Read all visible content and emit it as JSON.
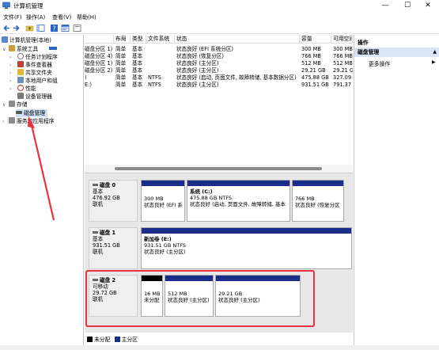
{
  "window": {
    "title": "计算机管理",
    "controls": {
      "minimize": "—",
      "maximize": "☐",
      "close": "✕"
    }
  },
  "menu": [
    "文件(F)",
    "操作(A)",
    "查看(V)",
    "帮助(H)"
  ],
  "tree": {
    "root": "计算机管理(本地)",
    "system_tools": "系统工具",
    "task_scheduler": "任务计划程序",
    "event_viewer": "事件查看器",
    "shared_folders": "共享文件夹",
    "local_users": "本地用户和组",
    "performance": "性能",
    "device_manager": "设备管理器",
    "storage": "存储",
    "disk_management": "磁盘管理",
    "services": "服务和应用程序"
  },
  "list": {
    "columns": [
      "布局",
      "类型",
      "文件系统",
      "状态",
      "容量",
      "可用空间"
    ],
    "rows": [
      {
        "name": "磁盘分区 1)",
        "layout": "简单",
        "type": "基本",
        "fs": "",
        "status": "状态良好 (EFI 系统分区)",
        "capacity": "300 MB",
        "free": "300 MB"
      },
      {
        "name": "磁盘分区 4)",
        "layout": "简单",
        "type": "基本",
        "fs": "",
        "status": "状态良好 (恢复分区)",
        "capacity": "766 MB",
        "free": "766 MB"
      },
      {
        "name": "磁盘分区 1)",
        "layout": "简单",
        "type": "基本",
        "fs": "",
        "status": "状态良好 (主分区)",
        "capacity": "512 MB",
        "free": "512 MB"
      },
      {
        "name": "磁盘分区 2)",
        "layout": "简单",
        "type": "基本",
        "fs": "",
        "status": "状态良好 (主分区)",
        "capacity": "29.21 GB",
        "free": "29.21 G"
      },
      {
        "name": ")",
        "layout": "简单",
        "type": "基本",
        "fs": "NTFS",
        "status": "状态良好 (启动, 页面文件, 故障转储, 基本数据分区)",
        "capacity": "475.88 GB",
        "free": "327.09"
      },
      {
        "name": "E:)",
        "layout": "简单",
        "type": "基本",
        "fs": "NTFS",
        "status": "状态良好 (主分区)",
        "capacity": "931.51 GB",
        "free": "791.37"
      }
    ]
  },
  "disks": [
    {
      "name": "磁盘 0",
      "type": "基本",
      "size": "476.92 GB",
      "state": "联机",
      "partitions": [
        {
          "title": "",
          "line1": "300 MB",
          "line2": "状态良好 (EFI 系",
          "bar": "blue"
        },
        {
          "title": "系统 (C:)",
          "line1": "475.88 GB NTFS",
          "line2": "状态良好 (启动, 页面文件, 故障转储, 基本",
          "bar": "blue"
        },
        {
          "title": "",
          "line1": "766 MB",
          "line2": "状态良好 (恢复分区",
          "bar": "blue"
        }
      ]
    },
    {
      "name": "磁盘 1",
      "type": "基本",
      "size": "931.51 GB",
      "state": "联机",
      "partitions": [
        {
          "title": "新加卷 (E:)",
          "line1": "931.51 GB NTFS",
          "line2": "状态良好 (主分区)",
          "bar": "blue"
        }
      ]
    },
    {
      "name": "磁盘 2",
      "type": "可移动",
      "size": "29.72 GB",
      "state": "联机",
      "partitions": [
        {
          "title": "",
          "line1": "16 MB",
          "line2": "未分配",
          "bar": "black"
        },
        {
          "title": "",
          "line1": "512 MB",
          "line2": "状态良好 (主分区)",
          "bar": "blue"
        },
        {
          "title": "",
          "line1": "29.21 GB",
          "line2": "状态良好 (主分区)",
          "bar": "blue"
        }
      ]
    }
  ],
  "legend": {
    "unallocated": "未分配",
    "primary": "主分区"
  },
  "actions": {
    "header": "操作",
    "selected": "磁盘管理",
    "more": "更多操作"
  },
  "colors": {
    "primary_partition": "#1a2d8b",
    "unallocated": "#000000",
    "annotation": "#e8323c"
  }
}
